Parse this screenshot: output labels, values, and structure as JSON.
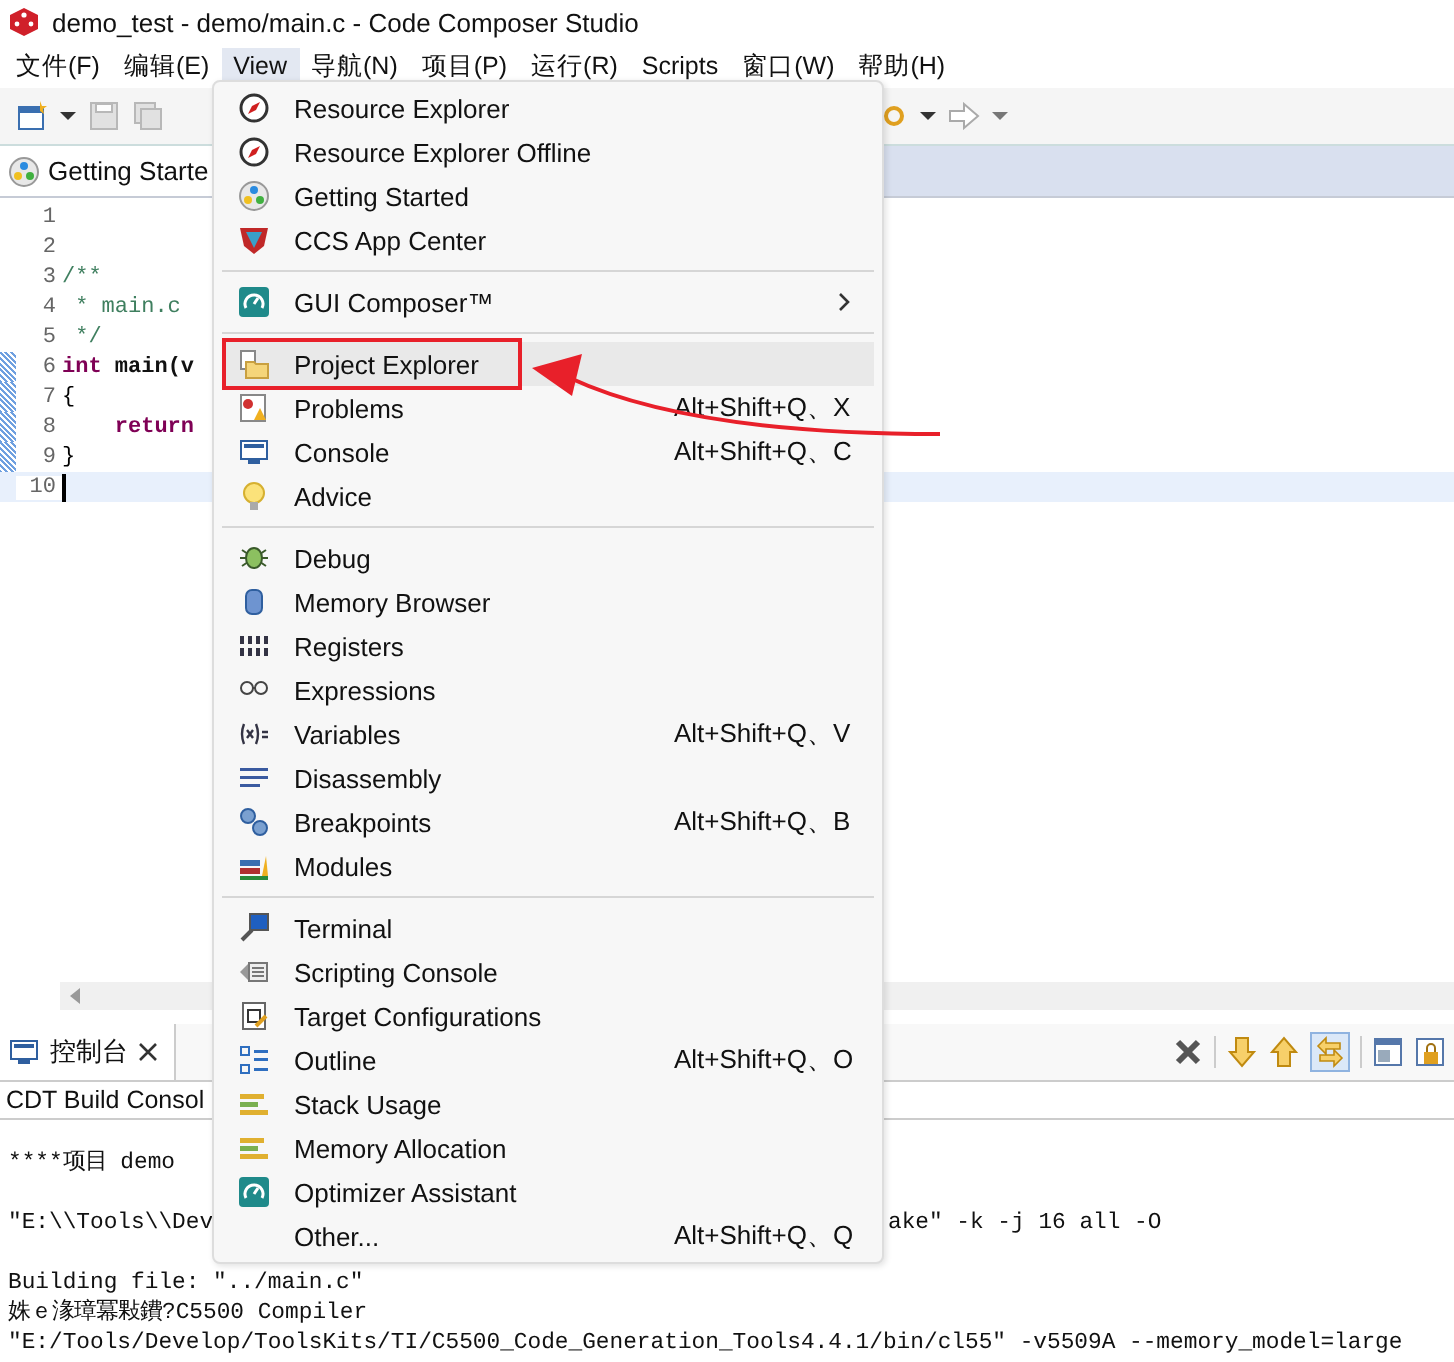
{
  "window": {
    "title": "demo_test - demo/main.c - Code Composer Studio"
  },
  "menubar": [
    {
      "label": "文件(F)",
      "selected": false
    },
    {
      "label": "编辑(E)",
      "selected": false
    },
    {
      "label": "View",
      "selected": true
    },
    {
      "label": "导航(N)",
      "selected": false
    },
    {
      "label": "项目(P)",
      "selected": false
    },
    {
      "label": "运行(R)",
      "selected": false
    },
    {
      "label": "Scripts",
      "selected": false
    },
    {
      "label": "窗口(W)",
      "selected": false
    },
    {
      "label": "帮助(H)",
      "selected": false
    }
  ],
  "editor": {
    "tab": {
      "title": "Getting Starte"
    },
    "lines": [
      {
        "number": "1",
        "changed": false,
        "current": false
      },
      {
        "number": "2",
        "changed": false,
        "current": false
      },
      {
        "number": "3",
        "changed": false,
        "current": false,
        "tokens": [
          {
            "text": "/**",
            "kind": "comment"
          }
        ]
      },
      {
        "number": "4",
        "changed": false,
        "current": false,
        "tokens": [
          {
            "text": " * main.c",
            "kind": "comment"
          }
        ]
      },
      {
        "number": "5",
        "changed": false,
        "current": false,
        "tokens": [
          {
            "text": " */",
            "kind": "comment"
          }
        ]
      },
      {
        "number": "6",
        "changed": true,
        "current": false,
        "tokens": [
          {
            "text": "int",
            "kind": "keyword"
          },
          {
            "text": " main(v",
            "kind": "bold"
          }
        ]
      },
      {
        "number": "7",
        "changed": true,
        "current": false,
        "tokens": [
          {
            "text": "{",
            "kind": "plain"
          }
        ]
      },
      {
        "number": "8",
        "changed": true,
        "current": false,
        "tokens": [
          {
            "text": "    return",
            "kind": "keyword"
          }
        ]
      },
      {
        "number": "9",
        "changed": true,
        "current": false,
        "tokens": [
          {
            "text": "}",
            "kind": "plain"
          }
        ]
      },
      {
        "number": "10",
        "changed": false,
        "current": true
      }
    ]
  },
  "view_menu": {
    "items": [
      {
        "kind": "item",
        "label": "Resource Explorer",
        "selected": false
      },
      {
        "kind": "item",
        "label": "Resource Explorer Offline",
        "selected": false
      },
      {
        "kind": "item",
        "label": "Getting Started",
        "selected": false
      },
      {
        "kind": "item",
        "label": "CCS App Center",
        "selected": false
      },
      {
        "kind": "separator"
      },
      {
        "kind": "item",
        "label": "GUI Composer™",
        "submenu": true,
        "selected": false
      },
      {
        "kind": "separator"
      },
      {
        "kind": "item",
        "label": "Project Explorer",
        "selected": true
      },
      {
        "kind": "item",
        "label": "Problems",
        "shortcut": "Alt+Shift+Q、X",
        "selected": false
      },
      {
        "kind": "item",
        "label": "Console",
        "shortcut": "Alt+Shift+Q、C",
        "selected": false
      },
      {
        "kind": "item",
        "label": "Advice",
        "selected": false
      },
      {
        "kind": "separator"
      },
      {
        "kind": "item",
        "label": "Debug",
        "selected": false
      },
      {
        "kind": "item",
        "label": "Memory Browser",
        "selected": false
      },
      {
        "kind": "item",
        "label": "Registers",
        "selected": false
      },
      {
        "kind": "item",
        "label": "Expressions",
        "selected": false
      },
      {
        "kind": "item",
        "label": "Variables",
        "shortcut": "Alt+Shift+Q、V",
        "selected": false
      },
      {
        "kind": "item",
        "label": "Disassembly",
        "selected": false
      },
      {
        "kind": "item",
        "label": "Breakpoints",
        "shortcut": "Alt+Shift+Q、B",
        "selected": false
      },
      {
        "kind": "item",
        "label": "Modules",
        "selected": false
      },
      {
        "kind": "separator"
      },
      {
        "kind": "item",
        "label": "Terminal",
        "selected": false
      },
      {
        "kind": "item",
        "label": "Scripting Console",
        "selected": false
      },
      {
        "kind": "item",
        "label": "Target Configurations",
        "selected": false
      },
      {
        "kind": "item",
        "label": "Outline",
        "shortcut": "Alt+Shift+Q、O",
        "selected": false
      },
      {
        "kind": "item",
        "label": "Stack Usage",
        "selected": false
      },
      {
        "kind": "item",
        "label": "Memory Allocation",
        "selected": false
      },
      {
        "kind": "item",
        "label": "Optimizer Assistant",
        "selected": false
      },
      {
        "kind": "item",
        "label": "Other...",
        "shortcut": "Alt+Shift+Q、Q",
        "selected": false
      }
    ]
  },
  "console": {
    "tab": {
      "title": "控制台"
    },
    "subtitle": "CDT Build Consol",
    "lines": [
      {
        "text": "****项目 demo",
        "blank_before": true
      },
      {
        "text": "\"E:\\\\Tools\\\\Dev",
        "tail": "ake\" -k -j 16 all -O",
        "blank_before": true
      },
      {
        "text": "Building file: \"../main.c\"",
        "blank_before": true
      },
      {
        "text": "姝ｅ湪璋冪敤鐨?C5500 Compiler",
        "blank_before": false
      },
      {
        "text": "\"E:/Tools/Develop/ToolsKits/TI/C5500_Code_Generation_Tools4.4.1/bin/cl55\" -v5509A --memory_model=large",
        "blank_before": false
      }
    ]
  }
}
